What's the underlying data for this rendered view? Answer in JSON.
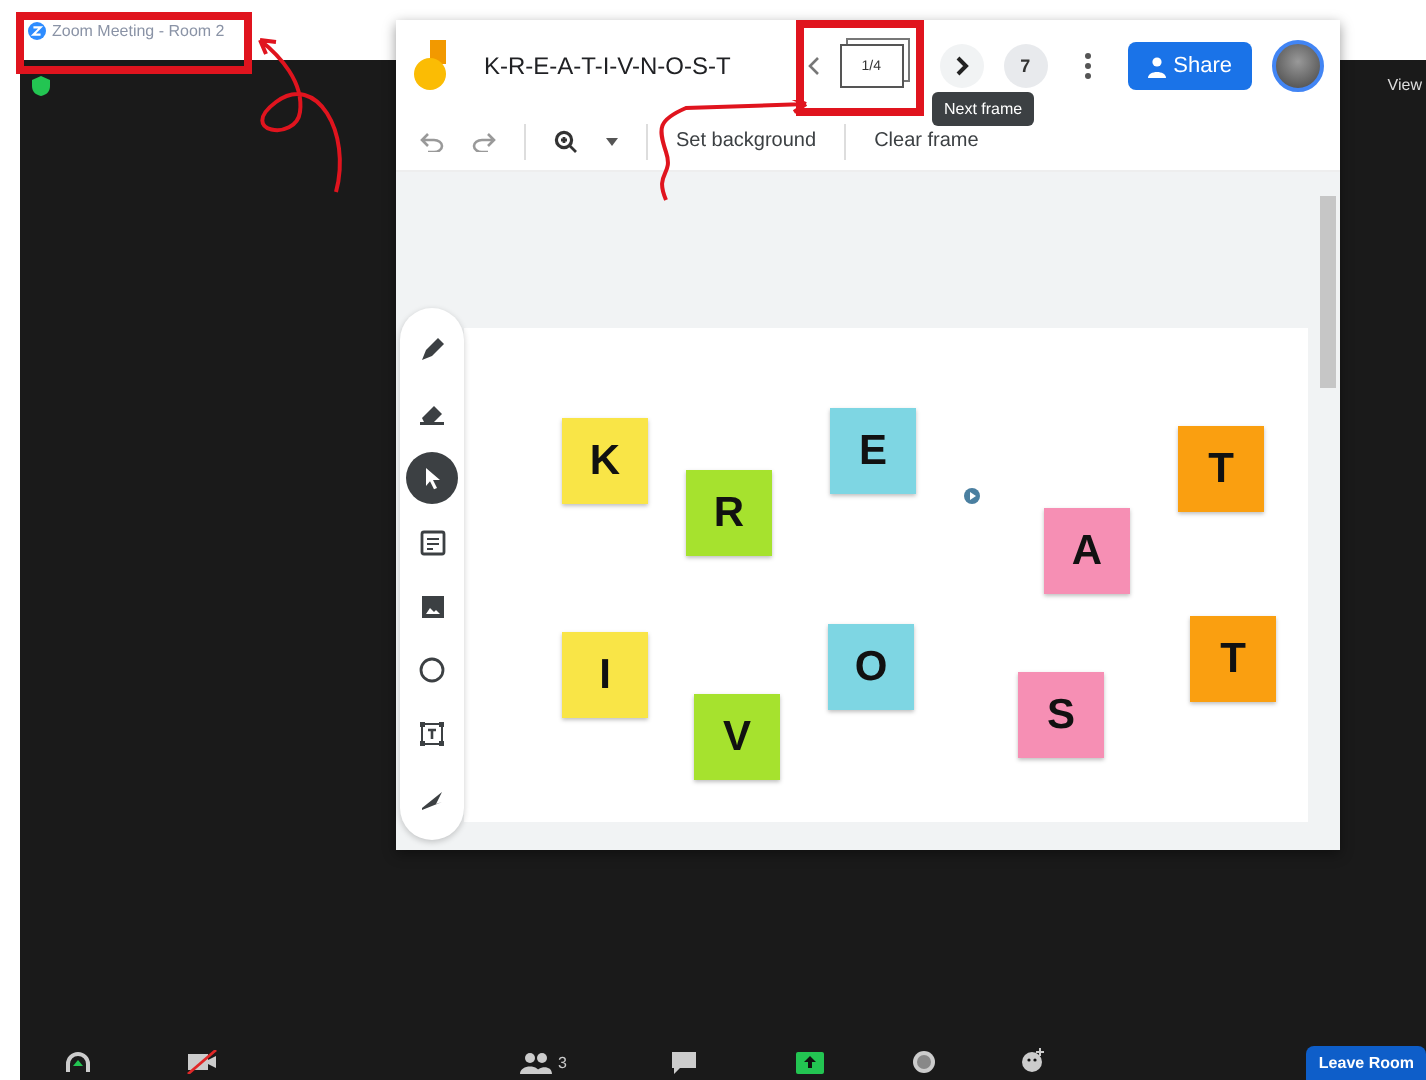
{
  "window": {
    "title": "Zoom Meeting - Room 2"
  },
  "view_button": "View",
  "jamboard": {
    "title": "K-R-E-A-T-I-V-N-O-S-T",
    "frame_counter": "1/4",
    "frame_count": "7",
    "share": "Share",
    "tooltip": "Next frame",
    "toolbar": [
      "Set background",
      "Clear frame"
    ],
    "tools": [
      {
        "kind": "pen",
        "selected": false
      },
      {
        "kind": "eraser",
        "selected": false
      },
      {
        "kind": "select",
        "selected": true
      },
      {
        "kind": "note",
        "selected": false
      },
      {
        "kind": "image",
        "selected": false
      },
      {
        "kind": "circle",
        "selected": false
      },
      {
        "kind": "textbox",
        "selected": false
      },
      {
        "kind": "laser",
        "selected": false
      }
    ],
    "notes": [
      {
        "letter": "K",
        "color": "#f9e547"
      },
      {
        "letter": "R",
        "color": "#a6e22e"
      },
      {
        "letter": "E",
        "color": "#7ed6e3"
      },
      {
        "letter": "A",
        "color": "#f68fb4"
      },
      {
        "letter": "T",
        "color": "#fa9f10"
      },
      {
        "letter": "I",
        "color": "#f9e547"
      },
      {
        "letter": "V",
        "color": "#a6e22e"
      },
      {
        "letter": "O",
        "color": "#7ed6e3"
      },
      {
        "letter": "S",
        "color": "#f68fb4"
      },
      {
        "letter": "T",
        "color": "#fa9f10"
      }
    ]
  },
  "bottom_bar": {
    "participants": "3",
    "leave": "Leave Room"
  }
}
